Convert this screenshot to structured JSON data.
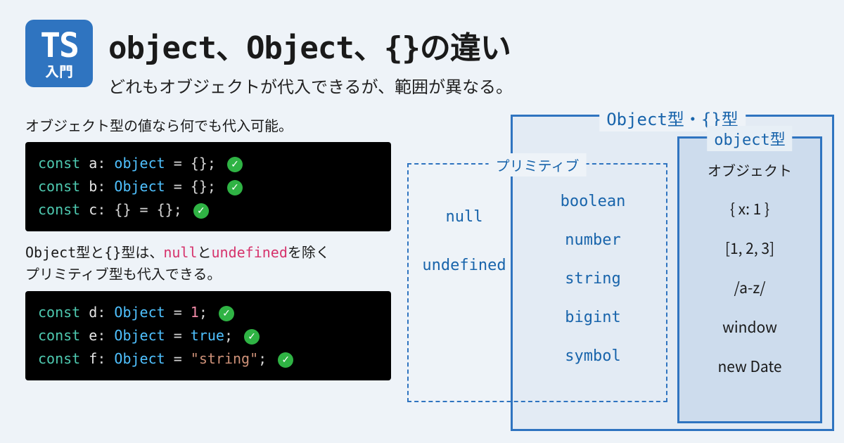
{
  "logo": {
    "ts": "TS",
    "sub": "入門"
  },
  "title": "object、Object、{}の違い",
  "subtitle": "どれもオブジェクトが代入できるが、範囲が異なる。",
  "section1_label": "オブジェクト型の値なら何でも代入可能。",
  "section2_label_parts": {
    "p1": "Object型と{}型は、",
    "nul": "null",
    "and": "と",
    "undef": "undefined",
    "p2": "を除く",
    "p3": "プリミティブ型も代入できる。"
  },
  "code1": {
    "l1": {
      "kw": "const",
      "var": "a",
      "type": "object",
      "rhs": "{}",
      "semi": ";"
    },
    "l2": {
      "kw": "const",
      "var": "b",
      "type": "Object",
      "rhs": "{}",
      "semi": ";"
    },
    "l3": {
      "kw": "const",
      "var": "c",
      "type": "{}",
      "rhs": "{}",
      "semi": ";"
    }
  },
  "code2": {
    "l1": {
      "kw": "const",
      "var": "d",
      "type": "Object",
      "rhs": "1",
      "semi": ";"
    },
    "l2": {
      "kw": "const",
      "var": "e",
      "type": "Object",
      "rhs": "true",
      "semi": ";"
    },
    "l3": {
      "kw": "const",
      "var": "f",
      "type": "Object",
      "rhs": "\"string\"",
      "semi": ";"
    }
  },
  "diagram": {
    "outer_label": "Object型・{}型",
    "inner_label": "object型",
    "prim_label": "プリミティブ",
    "prim_left": [
      "null",
      "undefined"
    ],
    "prim_right": [
      "boolean",
      "number",
      "string",
      "bigint",
      "symbol"
    ],
    "obj_header": "オブジェクト",
    "obj_items": [
      "{ x: 1 }",
      "[1, 2, 3]",
      "/a-z/",
      "window",
      "new Date"
    ]
  },
  "check": "✓"
}
